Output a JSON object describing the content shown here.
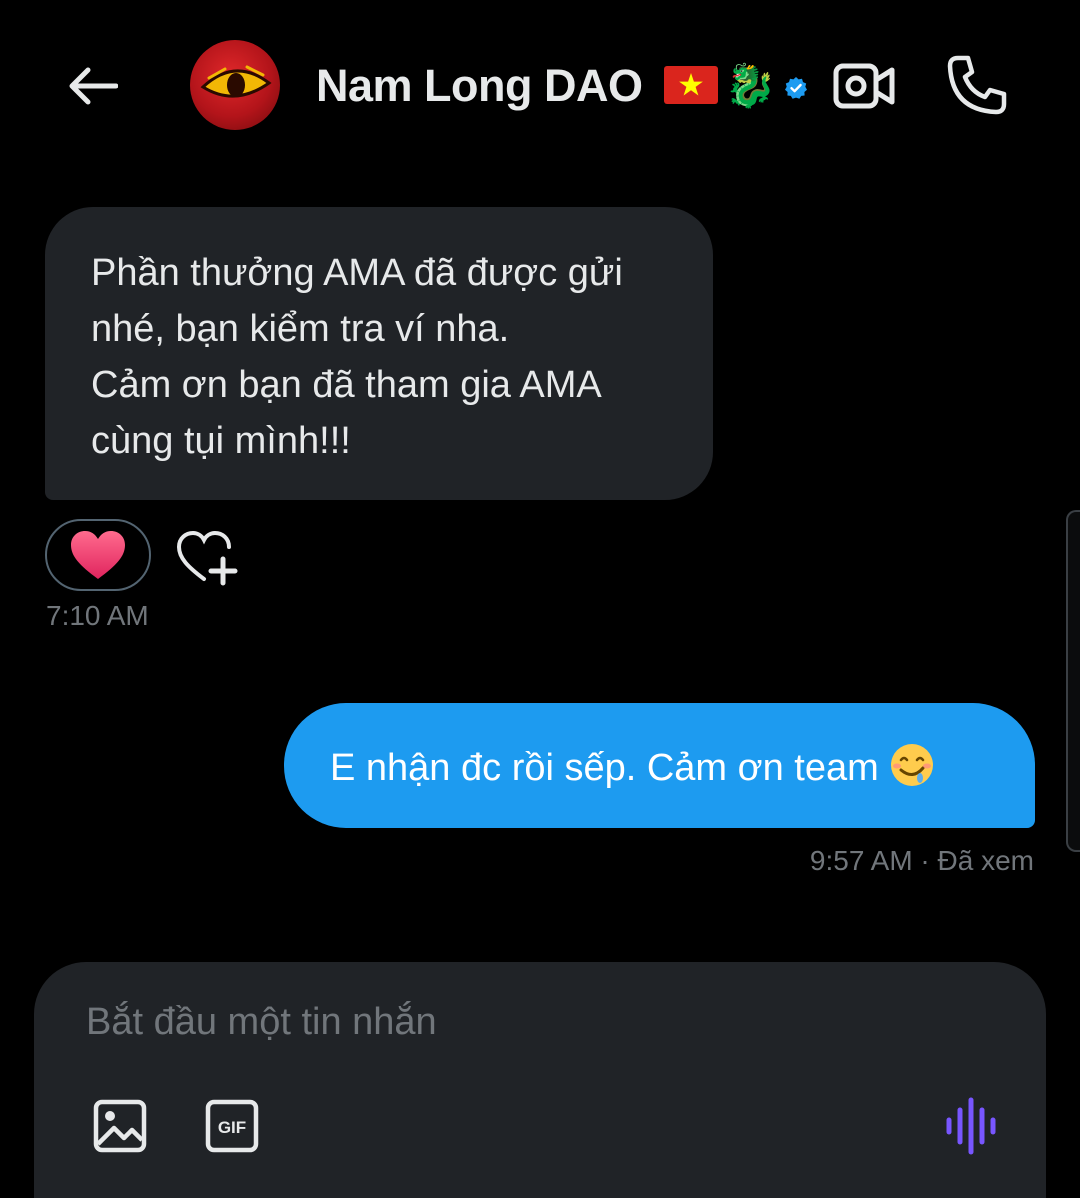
{
  "header": {
    "contact_name": "Nam Long DAO",
    "name_badges": [
      "vietnam-flag",
      "dragon",
      "verified"
    ],
    "accent_verified": "#1d9bf0"
  },
  "messages": [
    {
      "direction": "incoming",
      "text": "Phần thưởng AMA đã được gửi\nnhé, bạn kiểm tra ví nha.\nCảm ơn bạn đã tham gia AMA\ncùng tụi mình!!!",
      "reaction": "heart",
      "time": "7:10 AM"
    },
    {
      "direction": "outgoing",
      "text": "E nhận đc rồi sếp. Cảm ơn team",
      "emoji": "drooling-face",
      "time": "9:57 AM",
      "status": "Đã xem",
      "meta": "9:57 AM · Đã xem"
    }
  ],
  "composer": {
    "placeholder": "Bắt đầu một tin nhắn",
    "value": "",
    "gif_label": "GIF"
  },
  "colors": {
    "background": "#000000",
    "bubble_incoming": "#202327",
    "bubble_outgoing": "#1d9bf0",
    "voice_accent": "#7856ff",
    "muted_text": "#71767b"
  }
}
